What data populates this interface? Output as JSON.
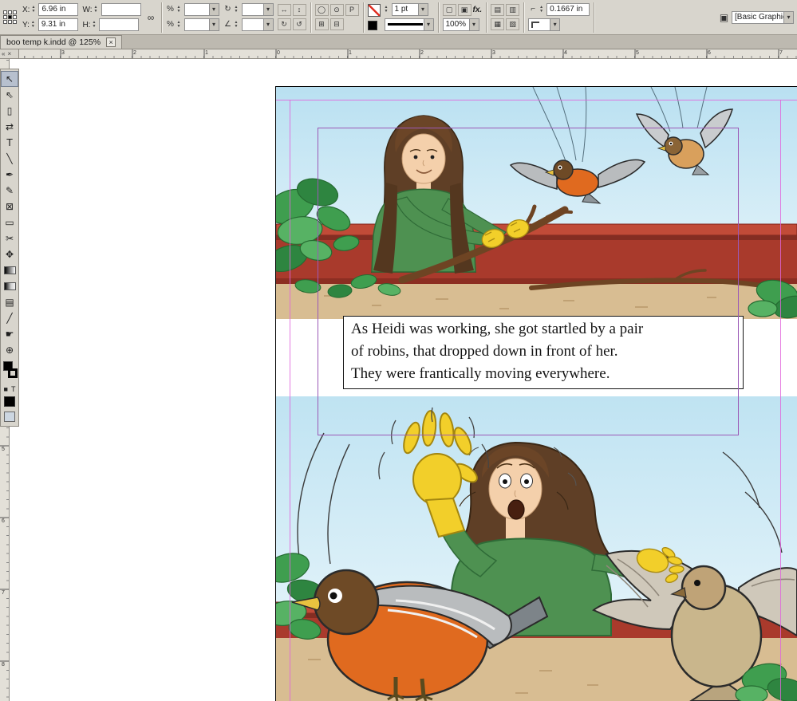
{
  "control_panel": {
    "x_label": "X:",
    "x_value": "6.96 in",
    "y_label": "Y:",
    "y_value": "9.31 in",
    "w_label": "W:",
    "w_value": "",
    "h_label": "H:",
    "h_value": "",
    "scale_x_value": "",
    "scale_y_value": "",
    "rotation_value": "",
    "shear_value": "",
    "stroke_weight": "1 pt",
    "fx_label": "fx.",
    "opacity": "100%",
    "corner_value": "0.1667 in",
    "style_value": "[Basic Graphics"
  },
  "icons": {
    "link": "∞",
    "scale_x": "%",
    "scale_y": "%",
    "rotate": "↻",
    "rotate_ccw": "↺",
    "shear": "∠",
    "flip_h": "↔",
    "flip_v": "↕",
    "select_container": "◯",
    "select_content": "⊙",
    "p_frame": "P",
    "structure_a": "⊞",
    "structure_b": "⊟",
    "doc_a": "▢",
    "doc_b": "▣",
    "wrap_a": "▤",
    "wrap_b": "▥",
    "wrap_c": "▦",
    "wrap_d": "▧",
    "corner": "⌐",
    "style": "▣",
    "collapse": "«",
    "corner_close": "×"
  },
  "tab_bar": {
    "tab_title": "boo  temp k.indd @ 125%",
    "close_label": "×"
  },
  "rulers": {
    "horizontal_numbers": [
      "3",
      "2",
      "1",
      "0",
      "1",
      "2",
      "3",
      "4",
      "5",
      "6",
      "7"
    ],
    "vertical_numbers": [
      "5",
      "6",
      "7",
      "8"
    ]
  },
  "tools": [
    {
      "name": "selection-tool",
      "glyph": "↖",
      "type": "glyph",
      "active": true
    },
    {
      "name": "direct-selection-tool",
      "glyph": "⇖",
      "type": "glyph"
    },
    {
      "name": "page-tool",
      "glyph": "▯",
      "type": "glyph"
    },
    {
      "name": "gap-tool",
      "glyph": "⇄",
      "type": "glyph"
    },
    {
      "name": "type-tool",
      "glyph": "T",
      "type": "glyph"
    },
    {
      "name": "line-tool",
      "glyph": "╲",
      "type": "glyph"
    },
    {
      "name": "pen-tool",
      "glyph": "✒",
      "type": "glyph"
    },
    {
      "name": "pencil-tool",
      "glyph": "✎",
      "type": "glyph"
    },
    {
      "name": "rectangle-frame-tool",
      "glyph": "⊠",
      "type": "glyph"
    },
    {
      "name": "rectangle-tool",
      "glyph": "▭",
      "type": "glyph"
    },
    {
      "name": "scissors-tool",
      "glyph": "✂",
      "type": "glyph"
    },
    {
      "name": "free-transform-tool",
      "glyph": "✥",
      "type": "glyph"
    },
    {
      "name": "gradient-swatch-tool",
      "type": "gradient"
    },
    {
      "name": "gradient-feather-tool",
      "type": "feather"
    },
    {
      "name": "note-tool",
      "glyph": "▤",
      "type": "glyph"
    },
    {
      "name": "eyedropper-tool",
      "glyph": "╱",
      "type": "glyph"
    },
    {
      "name": "hand-tool",
      "glyph": "☛",
      "type": "glyph"
    },
    {
      "name": "zoom-tool",
      "glyph": "⊕",
      "type": "glyph"
    }
  ],
  "tool_extras": {
    "formatting_container": "■",
    "formatting_text": "T"
  },
  "document": {
    "caption": "As Heidi was working, she got startled by a pair of robins, that dropped down in front of her. They were frantically moving everywhere.",
    "caption_lines": [
      "As Heidi was working, she got startled by a pair",
      "of robins, that dropped down in front of her.",
      "They were frantically moving everywhere."
    ]
  },
  "colors": {
    "chrome": "#d8d5cd",
    "guide": "#e064dc",
    "selection_frame": "#9b59b6",
    "planter_red": "#a93a2c",
    "sand": "#d8bd92",
    "foliage_green": "#3f9e4f",
    "shirt_green": "#4e9151",
    "glove_yellow": "#f2cf2a",
    "robin_orange": "#e06a1f",
    "hair_brown": "#5f3f26"
  }
}
